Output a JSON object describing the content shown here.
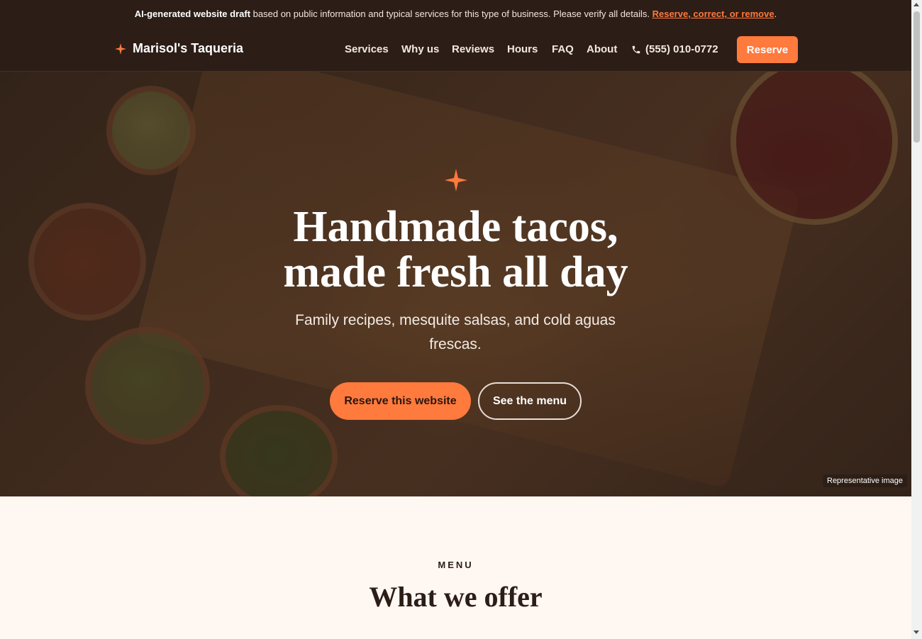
{
  "notice": {
    "bold": "AI-generated website draft",
    "text": "based on public information and typical services for this type of business. Please verify all details.",
    "link": "Reserve, correct, or remove",
    "end": "."
  },
  "brand": {
    "name": "Marisol's Taqueria"
  },
  "nav": {
    "items": [
      "Services",
      "Why us",
      "Reviews",
      "Hours",
      "FAQ",
      "About"
    ],
    "phone": "(555) 010-0772",
    "reserve": "Reserve"
  },
  "hero": {
    "title_line1": "Handmade tacos,",
    "title_line2": "made fresh all day",
    "subtitle": "Family recipes, mesquite salsas, and cold aguas frescas.",
    "primary_cta": "Reserve this website",
    "secondary_cta": "See the menu",
    "image_label": "Representative image"
  },
  "menu_section": {
    "eyebrow": "MENU",
    "title": "What we offer"
  },
  "colors": {
    "accent": "#ff7a3d",
    "dark": "#2c1d17",
    "cream": "#fff7f2"
  }
}
